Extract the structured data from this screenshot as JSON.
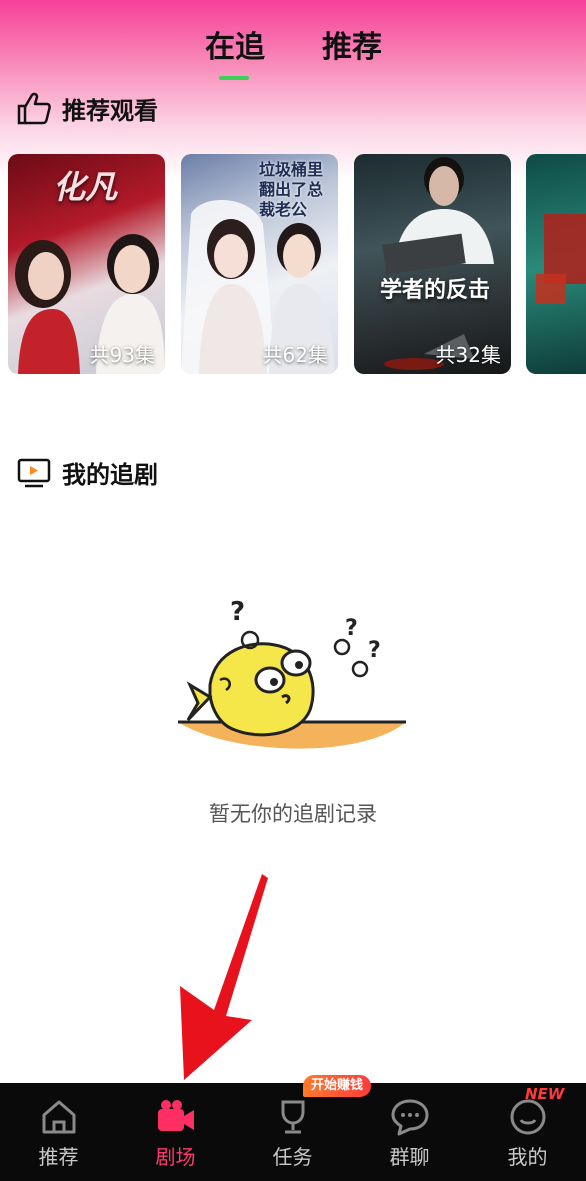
{
  "tabs": [
    {
      "label": "在追",
      "active": true
    },
    {
      "label": "推荐",
      "active": false
    }
  ],
  "accent_color": "#3cd05a",
  "recommend": {
    "title": "推荐观看",
    "icon": "thumbs-up-icon",
    "cards": [
      {
        "title_art": "化凡",
        "episodes": "共93集"
      },
      {
        "title_art": "垃圾桶里翻出了总裁老公",
        "episodes": "共62集"
      },
      {
        "title_art": "学者的反击",
        "episodes": "共32集"
      },
      {
        "title_art": "",
        "episodes": ""
      }
    ]
  },
  "my_shows": {
    "title": "我的追剧",
    "icon": "tv-icon",
    "empty_text": "暂无你的追剧记录"
  },
  "bottom_nav": {
    "items": [
      {
        "label": "推荐",
        "icon": "home-icon",
        "active": false
      },
      {
        "label": "剧场",
        "icon": "video-camera-icon",
        "active": true
      },
      {
        "label": "任务",
        "icon": "trophy-icon",
        "active": false
      },
      {
        "label": "群聊",
        "icon": "chat-bubble-icon",
        "active": false
      },
      {
        "label": "我的",
        "icon": "profile-icon",
        "active": false
      }
    ],
    "task_badge": "开始赚钱",
    "profile_badge": "NEW",
    "active_color": "#ff3a6e"
  }
}
